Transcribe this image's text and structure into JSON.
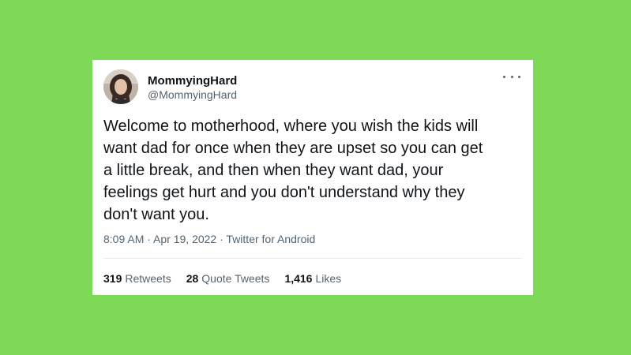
{
  "tweet": {
    "author_name": "MommyingHard",
    "author_handle": "@MommyingHard",
    "avatar_icon": "profile-photo",
    "more_icon": "more-horizontal-icon",
    "text": "Welcome to motherhood, where you wish the kids will\nwant dad for once when they are upset so you can get\na little break, and then when they want dad, your\nfeelings get hurt and you don't understand why they\ndon't want you.",
    "time": "8:09 AM",
    "date": "Apr 19, 2022",
    "source": "Twitter for Android",
    "separator": " · "
  },
  "stats": {
    "retweets_count": "319",
    "retweets_label": "Retweets",
    "quotes_count": "28",
    "quotes_label": "Quote Tweets",
    "likes_count": "1,416",
    "likes_label": "Likes"
  },
  "colors": {
    "background": "#7ed957",
    "card": "#ffffff",
    "text_primary": "#0f1419",
    "text_secondary": "#536471"
  }
}
